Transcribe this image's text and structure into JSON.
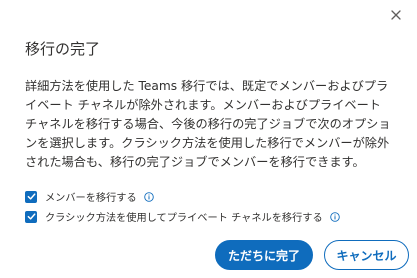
{
  "dialog": {
    "title": "移行の完了",
    "body": "詳細方法を使用した Teams 移行では、既定でメンバーおよびプライベート チャネルが除外されます。メンバーおよびプライベート チャネルを移行する場合、今後の移行の完了ジョブで次のオプションを選択します。クラシック方法を使用した移行でメンバーが除外された場合も、移行の完了ジョブでメンバーを移行できます。",
    "close_icon": "close-icon",
    "options": [
      {
        "label": "メンバーを移行する",
        "checked": true,
        "info_icon": "info-icon"
      },
      {
        "label": "クラシック方法を使用してプライベート チャネルを移行する",
        "checked": true,
        "info_icon": "info-icon"
      }
    ],
    "buttons": {
      "primary": "ただちに完了",
      "secondary": "キャンセル"
    }
  },
  "colors": {
    "accent": "#0f6cbd",
    "text": "#323130",
    "icon": "#605e5c"
  }
}
